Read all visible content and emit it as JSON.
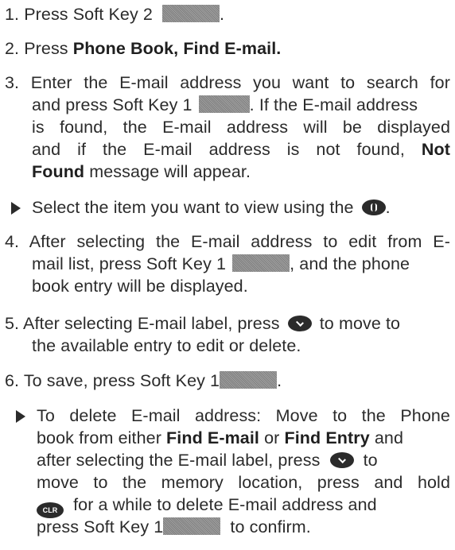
{
  "steps": {
    "s1": {
      "text": "1. Press Soft Key 2",
      "after": "."
    },
    "s2": {
      "pre": "2. Press ",
      "bold": "Phone Book, Find E-mail."
    },
    "s3": {
      "l1": "3. Enter the E-mail address you want to search for",
      "l2a": "and press Soft Key 1",
      "l2b": ". If the E-mail address",
      "l3": "is found, the E-mail address will be displayed",
      "l4a": "and if the E-mail address is not found,",
      "l4bold": "Not",
      "l5bold": "Found",
      "l5": " message will appear."
    },
    "b1": {
      "pre": "Select the item you want to view using the",
      "after": "."
    },
    "s4": {
      "l1": "4. After selecting the E-mail address to edit from E-",
      "l2a": "mail list, press Soft Key 1",
      "l2b": ", and the phone",
      "l3": "book entry will be displayed."
    },
    "s5": {
      "l1a": "5. After selecting E-mail label, press",
      "l1b": "to move to",
      "l2": "the available entry to edit or delete."
    },
    "s6": {
      "pre": "6. To save, press Soft Key 1",
      "after": "."
    },
    "b2": {
      "l1": "To delete E-mail address: Move to the Phone",
      "l2a": "book from either ",
      "l2bold1": "Find E-mail",
      "l2mid": " or ",
      "l2bold2": "Find Entry",
      "l2b": " and",
      "l3a": "after selecting the E-mail label, press",
      "l3b": "to",
      "l4": "move to the memory location, press and hold",
      "l5b": "for a while to delete E-mail address and",
      "l6a": "press Soft Key 1",
      "l6b": "to confirm."
    }
  },
  "icons": {
    "soft_key": "soft-key-placeholder",
    "nav_updown": "navigation-up-down-key",
    "nav_down": "navigation-down-key",
    "clr": "clear-key",
    "bullet": "triangle-bullet"
  },
  "clr_label": "CLR"
}
